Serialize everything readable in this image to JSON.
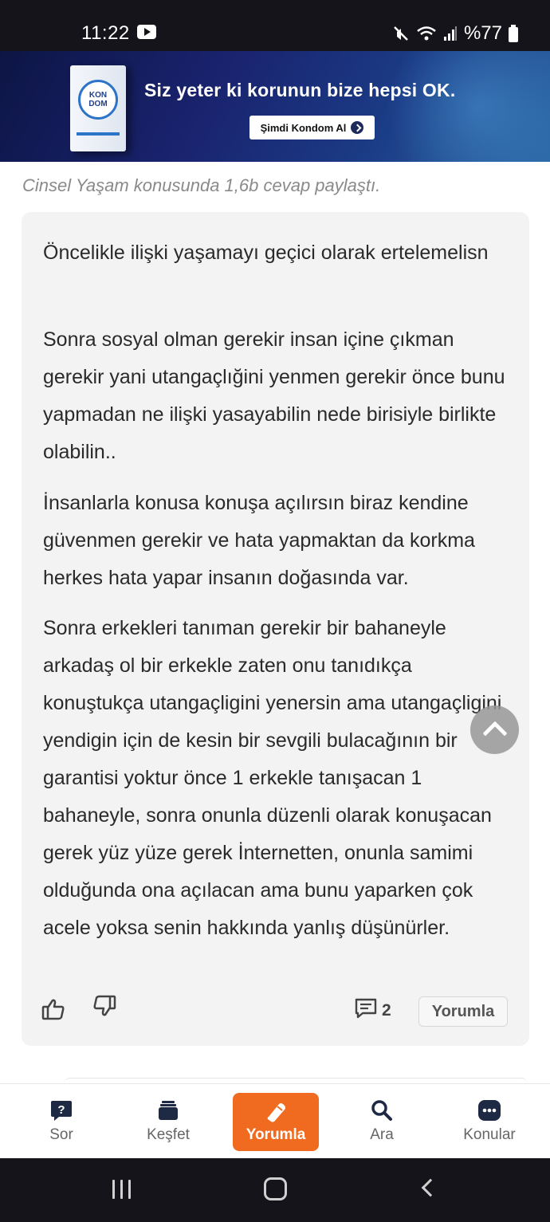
{
  "status_bar": {
    "time": "11:22",
    "battery": "%77",
    "icons": [
      "youtube-icon",
      "mute-icon",
      "wifi-icon",
      "signal-icon",
      "battery-icon"
    ]
  },
  "ad": {
    "brand_line1": "KON",
    "brand_line2": "DOM",
    "headline": "Siz yeter ki korunun bize hepsi OK.",
    "cta": "Şimdi Kondom Al"
  },
  "caption": "Cinsel Yaşam konusunda 1,6b cevap paylaştı.",
  "answer": {
    "paragraphs": [
      "Öncelikle ilişki yaşamayı geçici olarak ertelemelisn",
      "Sonra sosyal olman gerekir insan içine çıkman gerekir yani utangaçlığini yenmen gerekir önce bunu yapmadan ne ilişki yasayabilin nede birisiyle birlikte olabilin..",
      "İnsanlarla konusa konuşa açılırsın biraz kendine güvenmen gerekir ve hata yapmaktan da korkma herkes hata yapar insanın doğasında var.",
      "Sonra erkekleri tanıman gerekir bir bahaneyle arkadaş ol bir erkekle zaten onu tanıdıkça konuştukça utangaçligini yenersin ama utangaçligini yendigin için de kesin bir sevgili bulacağının bir garantisi yoktur önce 1 erkekle tanışacan 1 bahaneyle, sonra onunla düzenli olarak konuşacan gerek yüz yüze gerek İnternetten, onunla samimi olduğunda ona açılacan ama bunu yaparken çok acele yoksa senin hakkında yanlış düşünürler."
    ],
    "comment_count": "2",
    "reply_label": "Yorumla"
  },
  "bottom_nav": {
    "items": [
      {
        "label": "Sor",
        "icon": "question-icon"
      },
      {
        "label": "Keşfet",
        "icon": "stack-icon"
      },
      {
        "label": "Yorumla",
        "icon": "pencil-icon",
        "active": true
      },
      {
        "label": "Ara",
        "icon": "search-icon"
      },
      {
        "label": "Konular",
        "icon": "topics-icon"
      }
    ]
  },
  "colors": {
    "accent": "#f06a1f",
    "card_bg": "#f3f3f4",
    "system_bar": "#14141a"
  }
}
